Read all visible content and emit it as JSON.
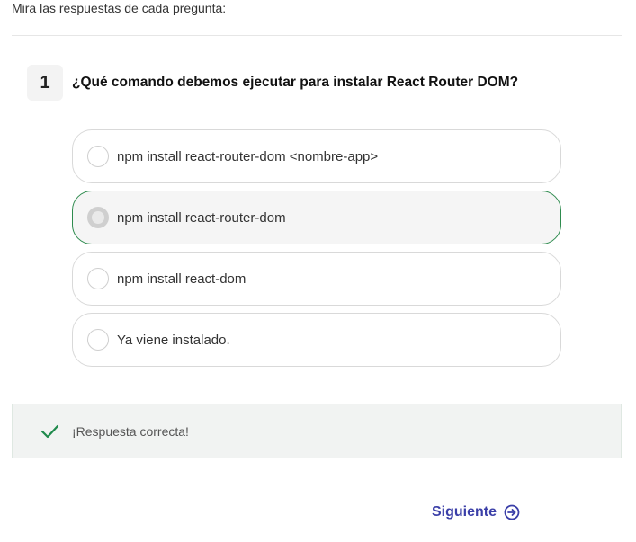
{
  "intro": "Mira las respuestas de cada pregunta:",
  "question": {
    "number": "1",
    "text": "¿Qué comando debemos ejecutar para instalar React Router DOM?"
  },
  "options": [
    {
      "label": "npm install react-router-dom <nombre-app>",
      "selected": false
    },
    {
      "label": "npm install react-router-dom",
      "selected": true
    },
    {
      "label": "npm install react-dom",
      "selected": false
    },
    {
      "label": "Ya viene instalado.",
      "selected": false
    }
  ],
  "feedback": {
    "text": "¡Respuesta correcta!",
    "icon": "checkmark-icon",
    "color": "#1f8a4c"
  },
  "next": {
    "label": "Siguiente",
    "icon": "arrow-right-circle-icon",
    "color": "#3b3fa8"
  }
}
